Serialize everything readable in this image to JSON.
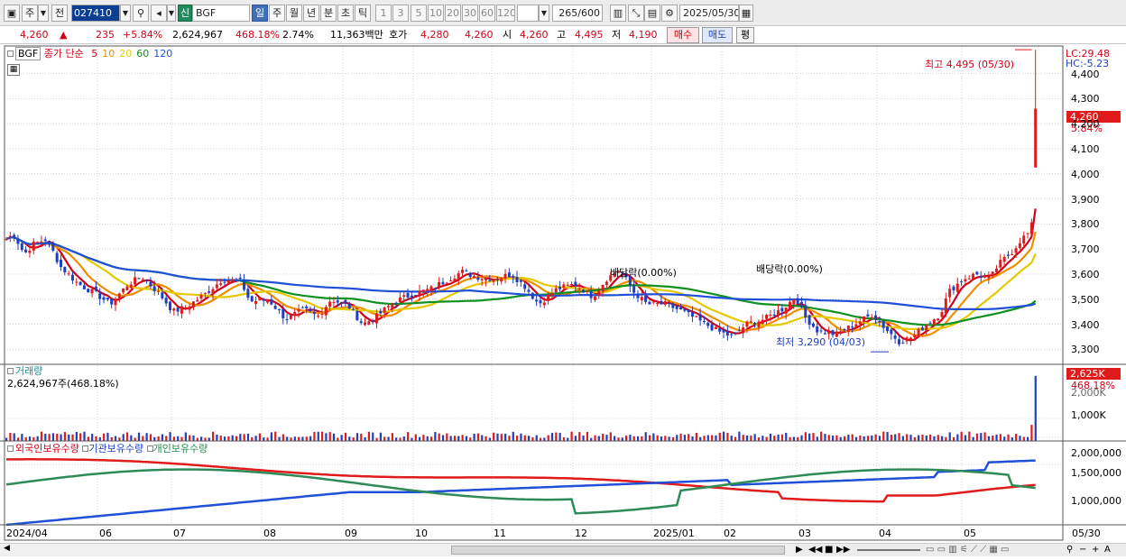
{
  "toolbar": {
    "market": "주",
    "prev_label": "전",
    "code": "027410",
    "name": "BGF",
    "new_badge": "신",
    "periods": [
      "일",
      "주",
      "월",
      "년",
      "분",
      "초",
      "틱"
    ],
    "active_period": "일",
    "intervals": [
      "1",
      "3",
      "5",
      "10",
      "20",
      "30",
      "60",
      "120"
    ],
    "count": "265",
    "count_max": "/600",
    "date": "2025/05/30"
  },
  "quote": {
    "price": "4,260",
    "arrow": "▲",
    "change": "235",
    "change_pct": "+5.84%",
    "volume": "2,624,967",
    "vol_ratio": "468.18%",
    "turnover": "2.74%",
    "amount": "11,363백만",
    "hoga_label": "호가",
    "ask": "4,280",
    "bid": "4,260",
    "open_label": "시",
    "open": "4,260",
    "high_label": "고",
    "high": "4,495",
    "low_label": "저",
    "low": "4,190",
    "buy_label": "매수",
    "sell_label": "매도",
    "avg_label": "평"
  },
  "price_panel": {
    "name": "BGF",
    "legend_label": "종가 단순",
    "ma": [
      {
        "p": "5",
        "color": "#d0021b"
      },
      {
        "p": "10",
        "color": "#f08c00"
      },
      {
        "p": "20",
        "color": "#e6c800"
      },
      {
        "p": "60",
        "color": "#109020"
      },
      {
        "p": "120",
        "color": "#2050d8"
      }
    ],
    "lc": "LC:29.48",
    "hc": "HC:-5.23",
    "high_note": "최고 4,495 (05/30)",
    "low_note": "최저 3,290 (04/03)",
    "div1": "배당락(0.00%)",
    "div2": "배당락(0.00%)",
    "cur_price": "4,260",
    "cur_pct": "5.84%",
    "yticks": [
      "4,400",
      "4,300",
      "4,200",
      "4,100",
      "4,000",
      "3,900",
      "3,800",
      "3,700",
      "3,600",
      "3,500",
      "3,400",
      "3,300"
    ]
  },
  "volume_panel": {
    "title": "거래량",
    "info": "2,624,967주(468.18%)",
    "cur": "2,625K",
    "pct": "468.18%",
    "ytick": "1,000K",
    "ytick2": "2,000K"
  },
  "holding_panel": {
    "s1": "외국인보유수량",
    "s2": "기관보유수량",
    "s3": "개인보유수량",
    "yticks": [
      "2,000,000",
      "1,500,000",
      "1,000,000"
    ]
  },
  "xaxis": {
    "labels": [
      "2024/04",
      "06",
      "07",
      "08",
      "09",
      "10",
      "11",
      "12",
      "2025/01",
      "02",
      "03",
      "04",
      "05"
    ],
    "end_label": "05/30"
  },
  "chart_data": {
    "type": "candlestick",
    "y_range": [
      3240,
      4510
    ],
    "high": 4495,
    "low": 3290,
    "last_close": 4260,
    "last_volume": 2624967,
    "closes": [
      [
        0,
        3740
      ],
      [
        8,
        3760
      ],
      [
        20,
        3680
      ],
      [
        30,
        3720
      ],
      [
        45,
        3740
      ],
      [
        60,
        3630
      ],
      [
        80,
        3560
      ],
      [
        100,
        3520
      ],
      [
        115,
        3480
      ],
      [
        135,
        3560
      ],
      [
        150,
        3590
      ],
      [
        170,
        3520
      ],
      [
        185,
        3450
      ],
      [
        200,
        3470
      ],
      [
        220,
        3520
      ],
      [
        240,
        3580
      ],
      [
        260,
        3570
      ],
      [
        270,
        3490
      ],
      [
        290,
        3500
      ],
      [
        310,
        3420
      ],
      [
        330,
        3460
      ],
      [
        345,
        3430
      ],
      [
        360,
        3500
      ],
      [
        380,
        3470
      ],
      [
        395,
        3400
      ],
      [
        410,
        3430
      ],
      [
        430,
        3490
      ],
      [
        450,
        3520
      ],
      [
        470,
        3540
      ],
      [
        490,
        3580
      ],
      [
        505,
        3610
      ],
      [
        520,
        3590
      ],
      [
        540,
        3580
      ],
      [
        560,
        3600
      ],
      [
        575,
        3550
      ],
      [
        590,
        3480
      ],
      [
        610,
        3540
      ],
      [
        630,
        3560
      ],
      [
        650,
        3510
      ],
      [
        665,
        3580
      ],
      [
        680,
        3620
      ],
      [
        695,
        3530
      ],
      [
        710,
        3480
      ],
      [
        730,
        3480
      ],
      [
        750,
        3450
      ],
      [
        770,
        3410
      ],
      [
        790,
        3370
      ],
      [
        805,
        3350
      ],
      [
        820,
        3400
      ],
      [
        840,
        3420
      ],
      [
        860,
        3460
      ],
      [
        875,
        3510
      ],
      [
        885,
        3430
      ],
      [
        900,
        3370
      ],
      [
        920,
        3360
      ],
      [
        940,
        3400
      ],
      [
        960,
        3440
      ],
      [
        975,
        3380
      ],
      [
        990,
        3330
      ],
      [
        1005,
        3350
      ],
      [
        1020,
        3400
      ],
      [
        1035,
        3440
      ],
      [
        1045,
        3530
      ],
      [
        1060,
        3580
      ],
      [
        1075,
        3600
      ],
      [
        1090,
        3580
      ],
      [
        1100,
        3640
      ],
      [
        1115,
        3690
      ],
      [
        1125,
        3740
      ],
      [
        1135,
        3770
      ],
      [
        1140,
        3860
      ],
      [
        1145,
        3920
      ],
      [
        1146,
        4260
      ]
    ]
  }
}
